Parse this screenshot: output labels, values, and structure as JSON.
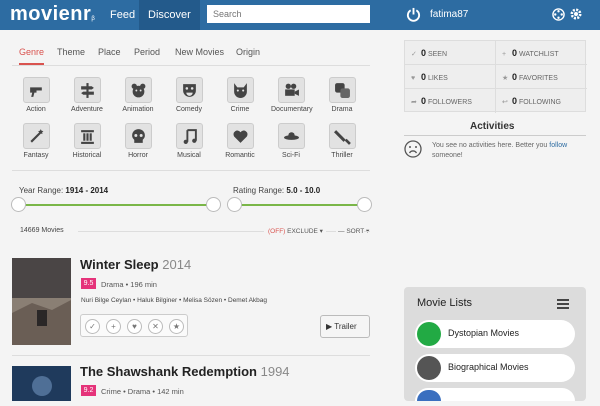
{
  "header": {
    "logo": "movienr",
    "logo_suffix": "β",
    "nav": [
      "Feed",
      "Discover"
    ],
    "search_placeholder": "Search",
    "username": "fatima87"
  },
  "tabs": [
    "Genre",
    "Theme",
    "Place",
    "Period",
    "New Movies",
    "Origin"
  ],
  "genres": [
    "Action",
    "Adventure",
    "Animation",
    "Comedy",
    "Crime",
    "Documentary",
    "Drama",
    "Fantasy",
    "Historical",
    "Horror",
    "Musical",
    "Romantic",
    "Sci-Fi",
    "Thriller"
  ],
  "year_range": {
    "label": "Year Range:",
    "value": "1914 - 2014"
  },
  "rating_range": {
    "label": "Rating Range:",
    "value": "5.0 - 10.0"
  },
  "results": {
    "count": "14669 Movies",
    "off": "(OFF)",
    "exclude": "EXCLUDE",
    "sort": "SORT"
  },
  "movies": [
    {
      "title": "Winter Sleep",
      "year": "2014",
      "rating": "9.5",
      "info": "Drama  •  196 min",
      "cast": "Nuri Bilge Ceylan  •  Haluk Bilginer  •  Melisa Sözen  •  Demet Akbag",
      "trailer": "Trailer"
    },
    {
      "title": "The Shawshank Redemption",
      "year": "1994",
      "rating": "9.2",
      "info": "Crime  •  Drama  •  142 min"
    }
  ],
  "stats": [
    {
      "num": "0",
      "label": "SEEN"
    },
    {
      "num": "0",
      "label": "WATCHLIST"
    },
    {
      "num": "0",
      "label": "LIKES"
    },
    {
      "num": "0",
      "label": "FAVORITES"
    },
    {
      "num": "0",
      "label": "FOLLOWERS"
    },
    {
      "num": "0",
      "label": "FOLLOWING"
    }
  ],
  "activities": {
    "title": "Activities",
    "empty_text": "You see no activities here. Better you",
    "link": "follow",
    "after": "someone!"
  },
  "movie_lists": {
    "title": "Movie Lists",
    "items": [
      "Dystopian Movies",
      "Biographical Movies"
    ]
  }
}
